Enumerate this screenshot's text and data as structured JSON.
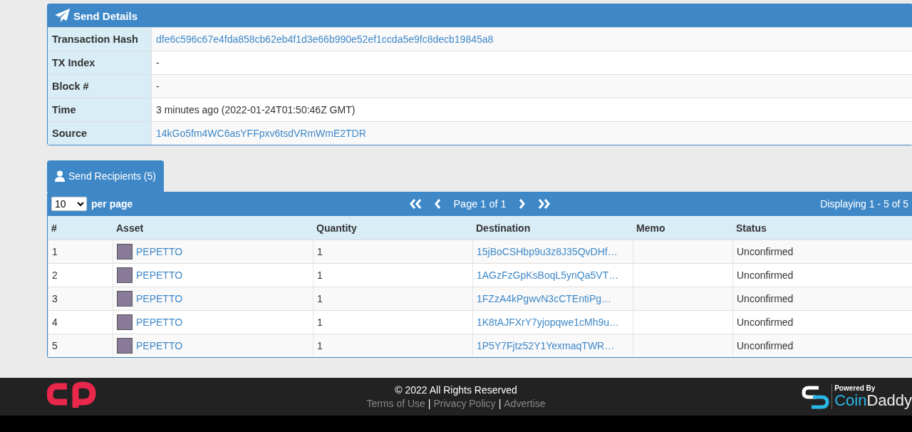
{
  "send_details": {
    "title": "Send Details",
    "rows": [
      {
        "label": "Transaction Hash",
        "value": "dfe6c596c67e4fda858cb62eb4f1d3e66b990e52ef1ccda5e9fc8decb19845a8",
        "kind": "link"
      },
      {
        "label": "TX Index",
        "value": "-",
        "kind": "text"
      },
      {
        "label": "Block #",
        "value": "-",
        "kind": "text"
      },
      {
        "label": "Time",
        "value": "3 minutes ago (2022-01-24T01:50:46Z GMT)",
        "kind": "text"
      },
      {
        "label": "Source",
        "value": "14kGo5fm4WC6asYFFpxv6tsdVRmWmE2TDR",
        "kind": "link"
      }
    ]
  },
  "recipients": {
    "tab": {
      "label": "Send Recipients (5)",
      "selected": true
    },
    "per_page": {
      "value": "10",
      "label": "per page"
    },
    "pager": {
      "page": "Page 1 of 1",
      "displaying": "Displaying 1 - 5 of 5"
    },
    "columns": [
      "#",
      "Asset",
      "Quantity",
      "Destination",
      "Memo",
      "Status"
    ],
    "rows": [
      {
        "index": "1",
        "asset": "PEPETTO",
        "quantity": "1",
        "destination": "15jBoCSHbp9u3z8J35QvDHf…",
        "status": "Unconfirmed"
      },
      {
        "index": "2",
        "asset": "PEPETTO",
        "quantity": "1",
        "destination": "1AGzFzGpKsBoqL5ynQa5VT…",
        "status": "Unconfirmed"
      },
      {
        "index": "3",
        "asset": "PEPETTO",
        "quantity": "1",
        "destination": "1FZzA4kPgwvN3cCTEntiPg…",
        "status": "Unconfirmed"
      },
      {
        "index": "4",
        "asset": "PEPETTO",
        "quantity": "1",
        "destination": "1K8tAJFXrY7yjopqwe1cMh9u…",
        "status": "Unconfirmed"
      },
      {
        "index": "5",
        "asset": "PEPETTO",
        "quantity": "1",
        "destination": "1P5Y7Fjtz52Y1YexmaqTWR…",
        "status": "Unconfirmed"
      }
    ]
  },
  "footer": {
    "copyright": "© 2022 All Rights Reserved",
    "links": [
      "Terms of Use",
      "Privacy Policy",
      "Advertise"
    ],
    "separator": "|",
    "powered_by": "Powered By",
    "brand_first": "Coin",
    "brand_second": "Daddy"
  }
}
